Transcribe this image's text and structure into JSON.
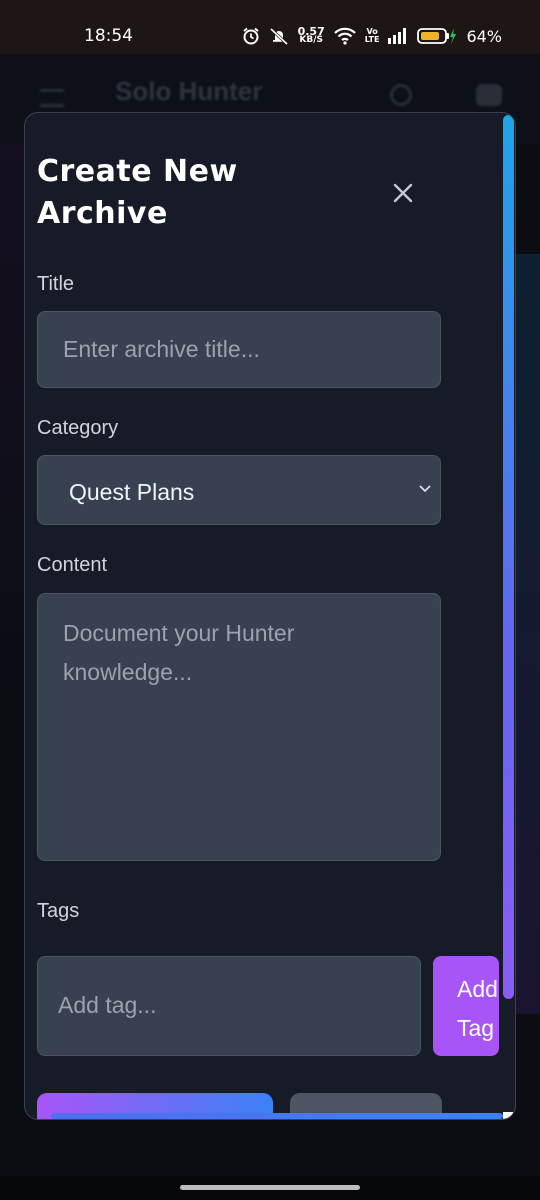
{
  "status_bar": {
    "time": "18:54",
    "net_speed_value": "0.57",
    "net_speed_unit": "KB/S",
    "volte_top": "Vo",
    "volte_bottom": "LTE",
    "battery_percent": "64%"
  },
  "background_app": {
    "title": "Solo Hunter"
  },
  "modal": {
    "title": "Create New Archive",
    "close_icon": "close-icon",
    "title_field": {
      "label": "Title",
      "placeholder": "Enter archive title..."
    },
    "category_field": {
      "label": "Category",
      "selected": "Quest Plans"
    },
    "content_field": {
      "label": "Content",
      "placeholder": "Document your Hunter knowledge..."
    },
    "tags_field": {
      "label": "Tags",
      "placeholder": "Add tag...",
      "add_button_label": "Add Tag"
    }
  },
  "colors": {
    "accent_purple": "#a855f7",
    "accent_blue": "#3b82f6",
    "modal_bg": "#161b27",
    "input_bg": "#374151"
  }
}
